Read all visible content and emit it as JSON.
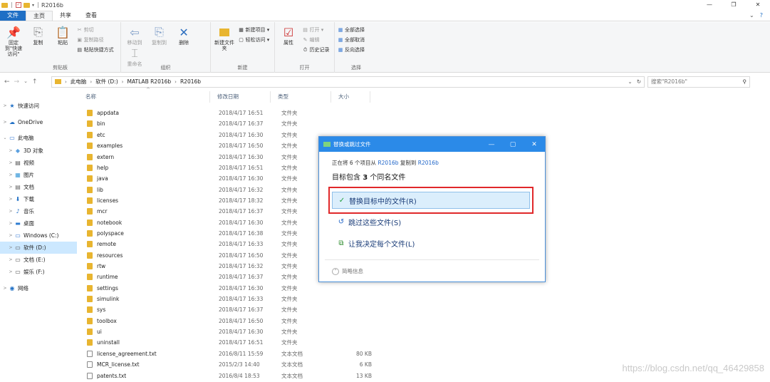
{
  "window": {
    "title": "R2016b",
    "controls": [
      "—",
      "❐",
      "✕"
    ]
  },
  "tabs": {
    "file": "文件",
    "home": "主页",
    "share": "共享",
    "view": "查看",
    "right": [
      "⌄",
      "?"
    ]
  },
  "ribbon": {
    "clipboard": {
      "pin": "固定到\"快速访问\"",
      "copy": "复制",
      "paste": "粘贴",
      "cut": "剪切",
      "copy_path": "复制路径",
      "paste_shortcut": "粘贴快捷方式",
      "group": "剪贴板"
    },
    "organize": {
      "move_to": "移动到",
      "copy_to": "复制到",
      "delete": "删除",
      "rename": "重命名",
      "group": "组织"
    },
    "new": {
      "new_folder": "新建文件夹",
      "new_item": "新建项目 ▾",
      "easy_access": "轻松访问 ▾",
      "group": "新建"
    },
    "open": {
      "properties": "属性",
      "open": "打开 ▾",
      "edit": "编辑",
      "history": "历史记录",
      "group": "打开"
    },
    "select": {
      "select_all": "全部选择",
      "select_none": "全部取消",
      "invert": "反向选择",
      "group": "选择"
    }
  },
  "address": {
    "nav": [
      "←",
      "→",
      "⌄",
      "↑"
    ],
    "path": [
      "此电脑",
      "软件 (D:)",
      "MATLAB R2016b",
      "R2016b"
    ],
    "search_placeholder": "搜索\"R2016b\""
  },
  "navpane": [
    {
      "label": "快速访问",
      "icon": "★",
      "color": "#1f6fc5"
    },
    {
      "label": "OneDrive",
      "icon": "☁",
      "color": "#1f6fc5"
    },
    {
      "label": "此电脑",
      "icon": "▭",
      "color": "#3a7bd5"
    },
    {
      "label": "3D 对象",
      "icon": "◆",
      "color": "#5aa0e0"
    },
    {
      "label": "视频",
      "icon": "▤",
      "color": "#555"
    },
    {
      "label": "图片",
      "icon": "▦",
      "color": "#3a9ad9"
    },
    {
      "label": "文档",
      "icon": "▤",
      "color": "#666"
    },
    {
      "label": "下载",
      "icon": "⬇",
      "color": "#1f6fc5"
    },
    {
      "label": "音乐",
      "icon": "♪",
      "color": "#1f6fc5"
    },
    {
      "label": "桌面",
      "icon": "▬",
      "color": "#2d7cd1"
    },
    {
      "label": "Windows (C:)",
      "icon": "▭",
      "color": "#3a7bd5"
    },
    {
      "label": "软件 (D:)",
      "icon": "▭",
      "color": "#555"
    },
    {
      "label": "文档 (E:)",
      "icon": "▭",
      "color": "#555"
    },
    {
      "label": "娱乐 (F:)",
      "icon": "▭",
      "color": "#555"
    },
    {
      "label": "网络",
      "icon": "◉",
      "color": "#1f6fc5"
    }
  ],
  "columns": [
    "名称",
    "修改日期",
    "类型",
    "大小"
  ],
  "files": [
    {
      "name": "appdata",
      "date": "2018/4/17 16:51",
      "type": "文件夹",
      "size": "",
      "kind": "folder"
    },
    {
      "name": "bin",
      "date": "2018/4/17 16:37",
      "type": "文件夹",
      "size": "",
      "kind": "folder"
    },
    {
      "name": "etc",
      "date": "2018/4/17 16:30",
      "type": "文件夹",
      "size": "",
      "kind": "folder"
    },
    {
      "name": "examples",
      "date": "2018/4/17 16:50",
      "type": "文件夹",
      "size": "",
      "kind": "folder"
    },
    {
      "name": "extern",
      "date": "2018/4/17 16:30",
      "type": "文件夹",
      "size": "",
      "kind": "folder"
    },
    {
      "name": "help",
      "date": "2018/4/17 16:51",
      "type": "文件夹",
      "size": "",
      "kind": "folder"
    },
    {
      "name": "java",
      "date": "2018/4/17 16:30",
      "type": "文件夹",
      "size": "",
      "kind": "folder"
    },
    {
      "name": "lib",
      "date": "2018/4/17 16:32",
      "type": "文件夹",
      "size": "",
      "kind": "folder"
    },
    {
      "name": "licenses",
      "date": "2018/4/17 18:32",
      "type": "文件夹",
      "size": "",
      "kind": "folder"
    },
    {
      "name": "mcr",
      "date": "2018/4/17 16:37",
      "type": "文件夹",
      "size": "",
      "kind": "folder"
    },
    {
      "name": "notebook",
      "date": "2018/4/17 16:30",
      "type": "文件夹",
      "size": "",
      "kind": "folder"
    },
    {
      "name": "polyspace",
      "date": "2018/4/17 16:38",
      "type": "文件夹",
      "size": "",
      "kind": "folder"
    },
    {
      "name": "remote",
      "date": "2018/4/17 16:33",
      "type": "文件夹",
      "size": "",
      "kind": "folder"
    },
    {
      "name": "resources",
      "date": "2018/4/17 16:50",
      "type": "文件夹",
      "size": "",
      "kind": "folder"
    },
    {
      "name": "rtw",
      "date": "2018/4/17 16:32",
      "type": "文件夹",
      "size": "",
      "kind": "folder"
    },
    {
      "name": "runtime",
      "date": "2018/4/17 16:37",
      "type": "文件夹",
      "size": "",
      "kind": "folder"
    },
    {
      "name": "settings",
      "date": "2018/4/17 16:30",
      "type": "文件夹",
      "size": "",
      "kind": "folder"
    },
    {
      "name": "simulink",
      "date": "2018/4/17 16:33",
      "type": "文件夹",
      "size": "",
      "kind": "folder"
    },
    {
      "name": "sys",
      "date": "2018/4/17 16:37",
      "type": "文件夹",
      "size": "",
      "kind": "folder"
    },
    {
      "name": "toolbox",
      "date": "2018/4/17 16:50",
      "type": "文件夹",
      "size": "",
      "kind": "folder"
    },
    {
      "name": "ui",
      "date": "2018/4/17 16:30",
      "type": "文件夹",
      "size": "",
      "kind": "folder"
    },
    {
      "name": "uninstall",
      "date": "2018/4/17 16:51",
      "type": "文件夹",
      "size": "",
      "kind": "folder"
    },
    {
      "name": "license_agreement.txt",
      "date": "2016/8/11 15:59",
      "type": "文本文档",
      "size": "80 KB",
      "kind": "doc"
    },
    {
      "name": "MCR_license.txt",
      "date": "2015/2/3 14:40",
      "type": "文本文档",
      "size": "6 KB",
      "kind": "doc"
    },
    {
      "name": "patents.txt",
      "date": "2016/8/4 18:53",
      "type": "文本文档",
      "size": "13 KB",
      "kind": "doc"
    }
  ],
  "dialog": {
    "title": "替换或跳过文件",
    "info_prefix": "正在将 6 个项目从 ",
    "info_src": "R2016b",
    "info_mid": " 复制到 ",
    "info_dst": "R2016b",
    "heading_prefix": "目标包含 ",
    "heading_count": "3",
    "heading_suffix": " 个同名文件",
    "options": [
      {
        "icon": "✓",
        "label": "替换目标中的文件(R)",
        "color": "#1e9e3a"
      },
      {
        "icon": "↺",
        "label": "跳过这些文件(S)",
        "color": "#1e64c8"
      },
      {
        "icon": "⧉",
        "label": "让我决定每个文件(L)",
        "color": "#2a8a2a"
      }
    ],
    "details": "简略信息"
  },
  "watermark": "https://blog.csdn.net/qq_46429858"
}
